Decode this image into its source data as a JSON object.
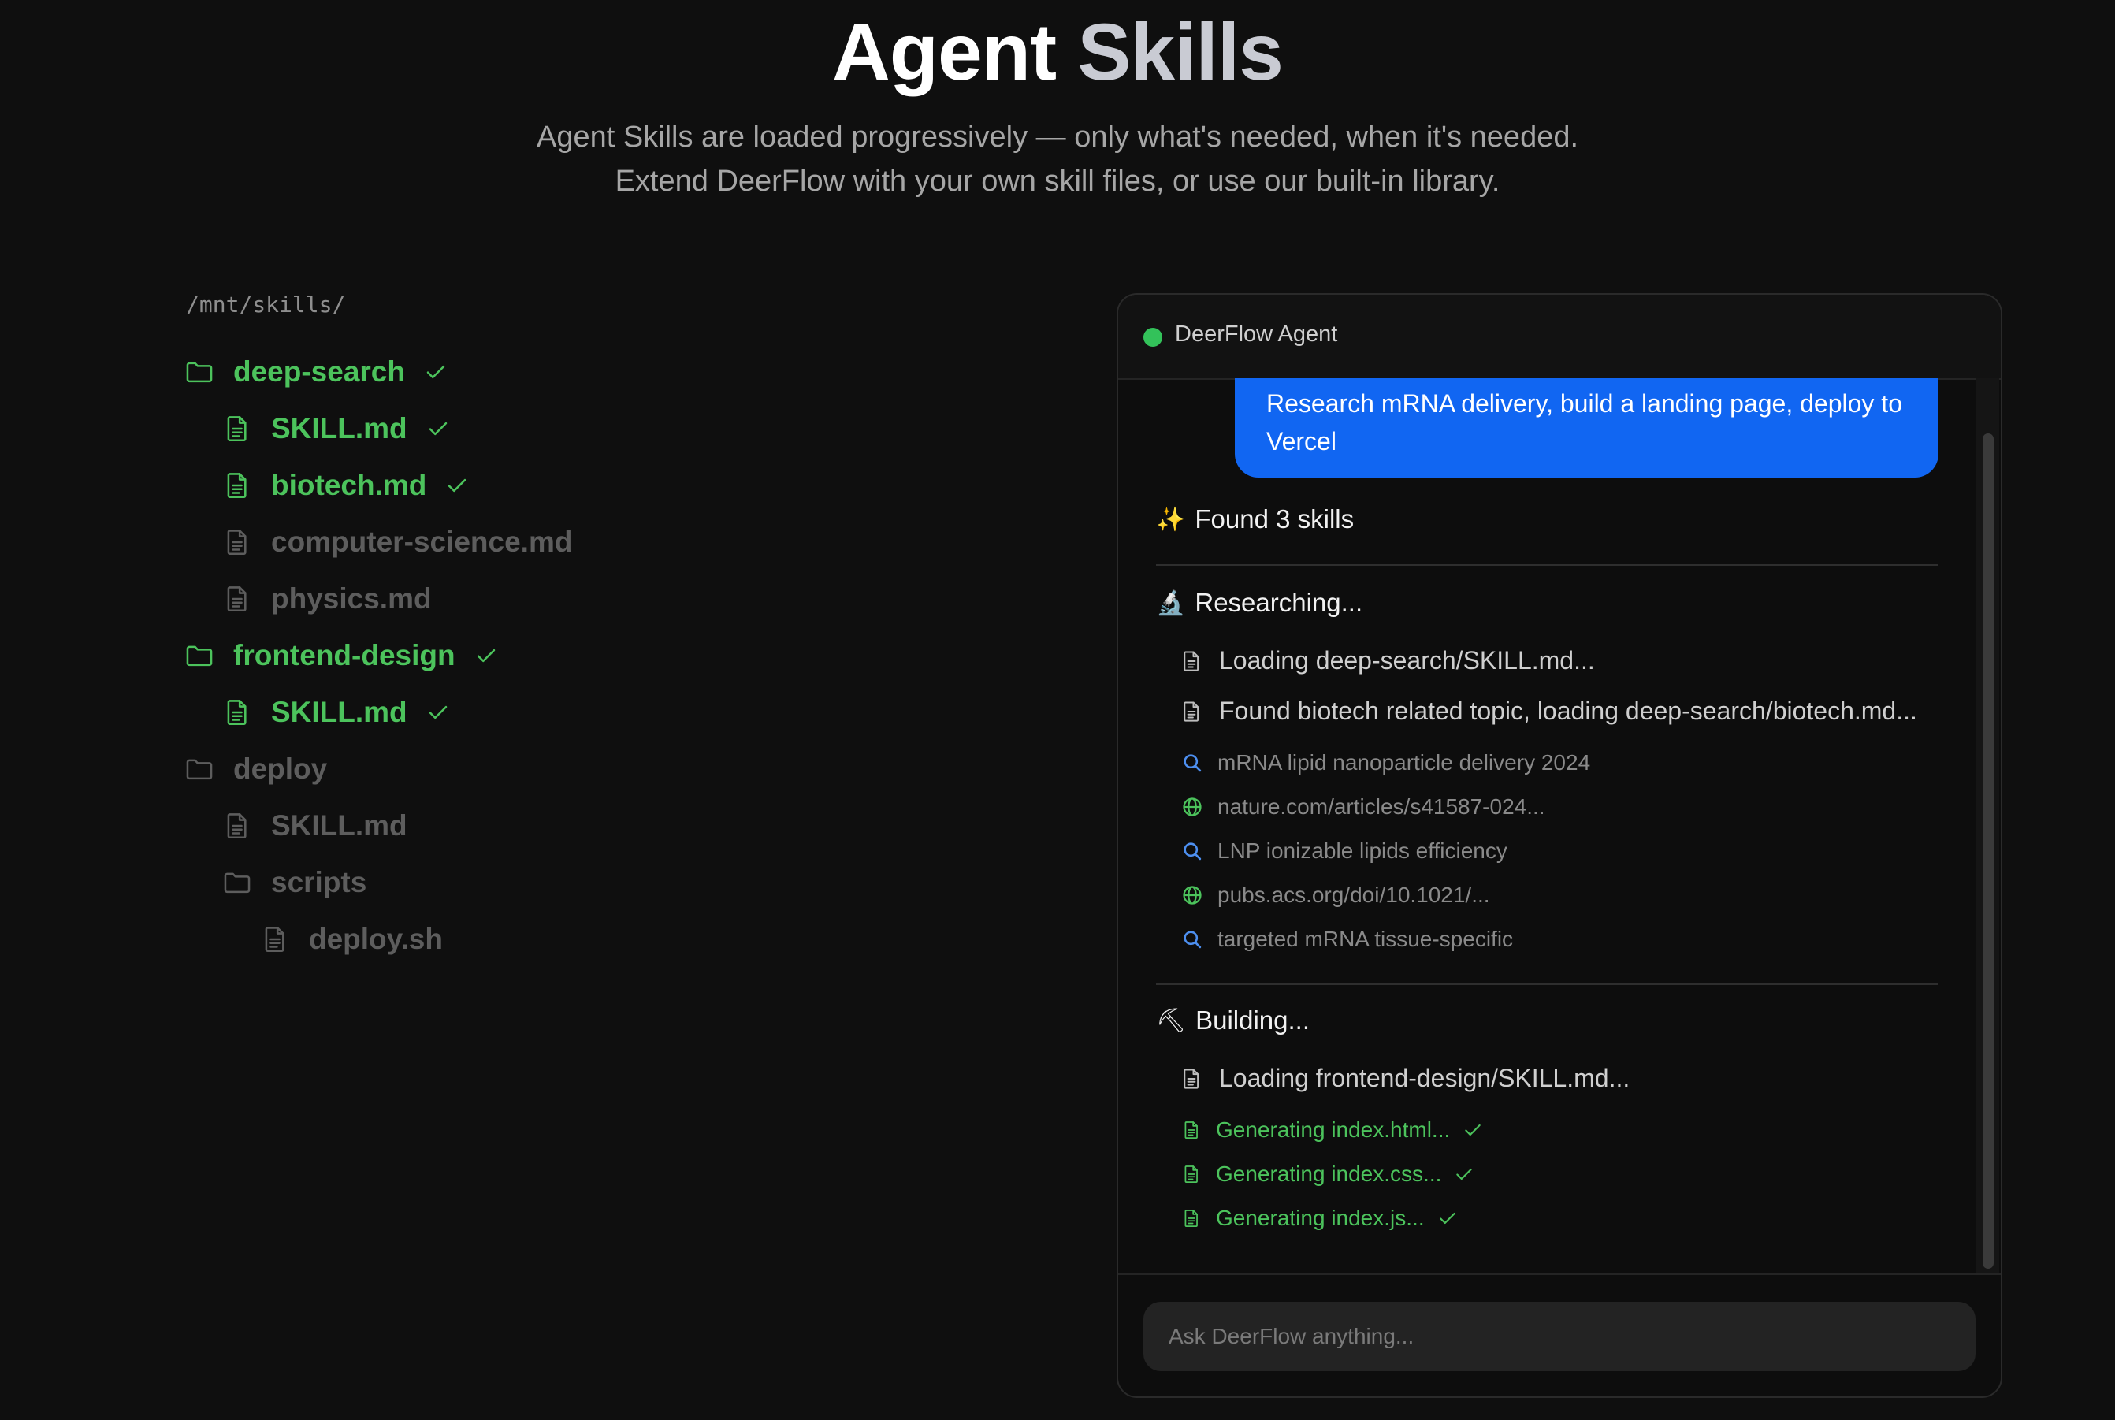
{
  "hero": {
    "title_word1": "Agent",
    "title_word2": "Skills",
    "subtitle_line1": "Agent Skills are loaded progressively — only what's needed, when it's needed.",
    "subtitle_line2": "Extend DeerFlow with your own skill files, or use our built-in library."
  },
  "tree": {
    "path": "/mnt/skills/",
    "items": [
      {
        "label": "deep-search",
        "kind": "folder",
        "loaded": true
      },
      {
        "label": "SKILL.md",
        "kind": "file",
        "loaded": true
      },
      {
        "label": "biotech.md",
        "kind": "file",
        "loaded": true
      },
      {
        "label": "computer-science.md",
        "kind": "file",
        "loaded": false
      },
      {
        "label": "physics.md",
        "kind": "file",
        "loaded": false
      },
      {
        "label": "frontend-design",
        "kind": "folder",
        "loaded": true
      },
      {
        "label": "SKILL.md",
        "kind": "file",
        "loaded": true
      },
      {
        "label": "deploy",
        "kind": "folder",
        "loaded": false
      },
      {
        "label": "SKILL.md",
        "kind": "file",
        "loaded": false
      },
      {
        "label": "scripts",
        "kind": "folder",
        "loaded": false
      },
      {
        "label": "deploy.sh",
        "kind": "file",
        "loaded": false
      }
    ]
  },
  "chat": {
    "header": "DeerFlow Agent",
    "user_message": "Research mRNA delivery, build a landing page, deploy to Vercel",
    "found_emoji": "✨",
    "found": "Found 3 skills",
    "research_emoji": "🔬",
    "research_title": "Researching...",
    "research_items": [
      "Loading deep-search/SKILL.md...",
      "Found biotech related topic, loading deep-search/biotech.md..."
    ],
    "research_sources": [
      {
        "icon": "search-icon",
        "text": "mRNA lipid nanoparticle delivery 2024"
      },
      {
        "icon": "globe-icon",
        "text": "nature.com/articles/s41587-024..."
      },
      {
        "icon": "search-icon",
        "text": "LNP ionizable lipids efficiency"
      },
      {
        "icon": "globe-icon",
        "text": "pubs.acs.org/doi/10.1021/..."
      },
      {
        "icon": "search-icon",
        "text": "targeted mRNA tissue-specific"
      }
    ],
    "build_emoji": "⛏",
    "build_title": "Building...",
    "build_items": [
      "Loading frontend-design/SKILL.md..."
    ],
    "generated": [
      "Generating index.html...",
      "Generating index.css...",
      "Generating index.js..."
    ],
    "input_placeholder": "Ask DeerFlow anything..."
  },
  "colors": {
    "background": "#0f0f0f",
    "accent_green": "#4cc35c",
    "user_bubble": "#1166f2",
    "status_dot": "#33c25a",
    "search_icon": "#4d8ff0"
  }
}
